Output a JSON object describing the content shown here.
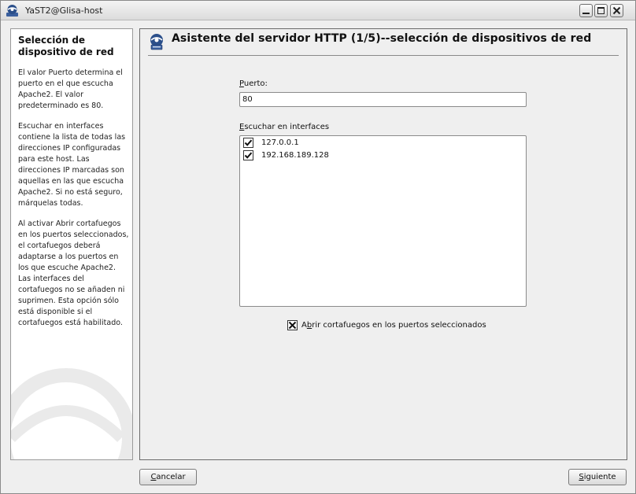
{
  "window": {
    "title": "YaST2@Glisa-host"
  },
  "help": {
    "title": "Selección de dispositivo de red",
    "paragraphs": [
      "El valor Puerto determina el puerto en el que escucha Apache2. El valor predeterminado es 80.",
      "Escuchar en interfaces contiene la lista de todas las direcciones IP configuradas para este host. Las direcciones IP marcadas son aquellas en las que escucha Apache2. Si no está seguro, márquelas todas.",
      "Al activar Abrir cortafuegos en los puertos seleccionados, el cortafuegos deberá adaptarse a los puertos en los que escuche Apache2. Las interfaces del cortafuegos no se añaden ni suprimen. Esta opción sólo está disponible si el cortafuegos está habilitado."
    ]
  },
  "main": {
    "heading": "Asistente del servidor HTTP (1/5)--selección de dispositivos de red",
    "port_label_first": "P",
    "port_label_rest": "uerto:",
    "port_value": "80",
    "interfaces_label_first": "E",
    "interfaces_label_rest": "scuchar en interfaces",
    "interfaces": [
      {
        "address": "127.0.0.1",
        "checked": true
      },
      {
        "address": "192.168.189.128",
        "checked": true
      }
    ],
    "firewall_label_first": "A",
    "firewall_label_mid": "b",
    "firewall_label_rest": "rir cortafuegos en los puertos seleccionados",
    "firewall_checked": true
  },
  "buttons": {
    "cancel_first": "C",
    "cancel_rest": "ancelar",
    "next_first": "S",
    "next_rest": "iguiente"
  },
  "colors": {
    "window_bg": "#efefef",
    "panel_border": "#6a6a6a"
  }
}
